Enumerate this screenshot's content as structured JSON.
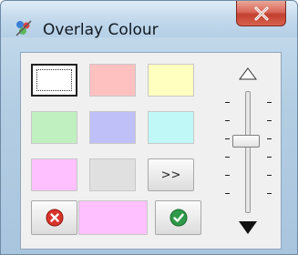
{
  "window": {
    "title": "Overlay Colour",
    "close_glyph": "X"
  },
  "swatches": [
    {
      "name": "white",
      "color": "#ffffff",
      "selected": true
    },
    {
      "name": "pink",
      "color": "#ffc0c0",
      "selected": false
    },
    {
      "name": "yellow",
      "color": "#ffffc0",
      "selected": false
    },
    {
      "name": "green",
      "color": "#c0f0c0",
      "selected": false
    },
    {
      "name": "lavender",
      "color": "#c0c0f8",
      "selected": false
    },
    {
      "name": "cyan",
      "color": "#c0f8f8",
      "selected": false
    },
    {
      "name": "magenta",
      "color": "#ffc0ff",
      "selected": false
    },
    {
      "name": "grey",
      "color": "#e0e0e0",
      "selected": false
    }
  ],
  "more_button": {
    "label": ">>"
  },
  "preview": {
    "color": "#ffc0ff"
  },
  "actions": {
    "cancel_icon": "red-cross-icon",
    "ok_icon": "green-check-icon"
  },
  "slider": {
    "up_icon": "outline-up-triangle-icon",
    "down_icon": "filled-down-triangle-icon",
    "level": 0.6
  }
}
